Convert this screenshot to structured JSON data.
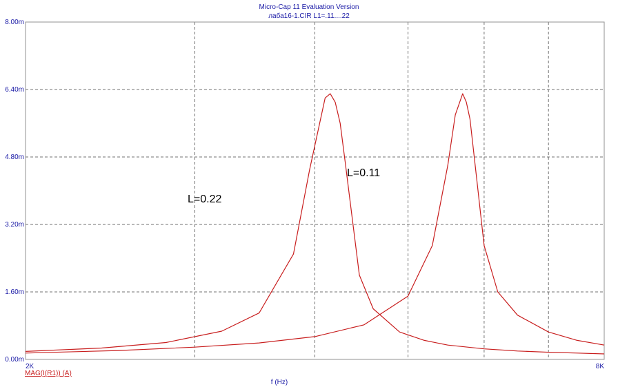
{
  "chart_data": {
    "type": "line",
    "title": "Micro-Cap 11 Evaluation Version",
    "subtitle": "лаба16-1.CIR L1=.11....22",
    "xlabel": "f (Hz)",
    "ylabel": "",
    "xlim": [
      2000,
      8000
    ],
    "ylim": [
      0,
      0.008
    ],
    "x_tick_labels": [
      "2K",
      "8K"
    ],
    "y_tick_labels": [
      "0.00m",
      "1.60m",
      "3.20m",
      "4.80m",
      "6.40m",
      "8.00m"
    ],
    "y_ticks": [
      0,
      0.0016,
      0.0032,
      0.0048,
      0.0064,
      0.008
    ],
    "grid": true,
    "legend": "MAG(I(R1)) (A)",
    "series": [
      {
        "annotation": "L=0.22",
        "color": "#c81e1e",
        "x": [
          2000,
          2400,
          2800,
          3200,
          3500,
          3800,
          3950,
          4100,
          4150,
          4200,
          4250,
          4300,
          4450,
          4600,
          4900,
          5200,
          5500,
          6000,
          6500,
          7000,
          7500,
          8000
        ],
        "y": [
          0.00019,
          0.00027,
          0.0004,
          0.00067,
          0.0011,
          0.0025,
          0.0045,
          0.0062,
          0.0063,
          0.0061,
          0.0056,
          0.0047,
          0.002,
          0.0012,
          0.00065,
          0.00045,
          0.00034,
          0.00025,
          0.0002,
          0.00017,
          0.00015,
          0.00013
        ]
      },
      {
        "annotation": "L=0.11",
        "color": "#c81e1e",
        "x": [
          2000,
          2500,
          3000,
          3500,
          4000,
          4500,
          5000,
          5300,
          5500,
          5600,
          5700,
          5750,
          5800,
          5900,
          6000,
          6200,
          6500,
          7000,
          7500,
          8000
        ],
        "y": [
          0.00015,
          0.00021,
          0.00029,
          0.00039,
          0.00054,
          0.00082,
          0.0015,
          0.0027,
          0.0046,
          0.0058,
          0.0063,
          0.0061,
          0.0057,
          0.0042,
          0.0027,
          0.0016,
          0.00105,
          0.00065,
          0.00045,
          0.00034
        ]
      }
    ]
  }
}
